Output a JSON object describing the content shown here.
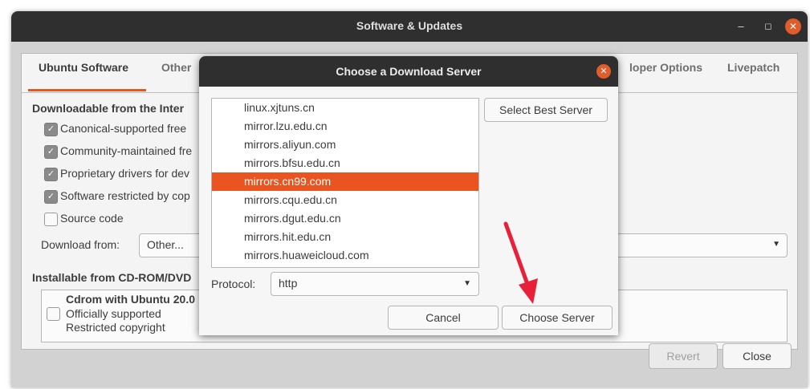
{
  "window": {
    "title": "Software & Updates",
    "controls": {
      "minimize": "–",
      "maximize": "◻",
      "close": "✕"
    }
  },
  "tabs": [
    {
      "label": "Ubuntu Software",
      "active": true
    },
    {
      "label": "Other",
      "active": false
    },
    {
      "label": "loper Options",
      "active": false
    },
    {
      "label": "Livepatch",
      "active": false
    }
  ],
  "downloadable": {
    "title": "Downloadable from the Inter",
    "items": [
      {
        "label": "Canonical-supported free",
        "checked": true
      },
      {
        "label": "Community-maintained fre",
        "checked": true
      },
      {
        "label": "Proprietary drivers for dev",
        "checked": true
      },
      {
        "label": "Software restricted by cop",
        "checked": true
      },
      {
        "label": "Source code",
        "checked": false
      }
    ],
    "download_from_label": "Download from:",
    "download_from_value": "Other..."
  },
  "cdrom": {
    "title": "Installable from CD-ROM/DVD",
    "name": "Cdrom with Ubuntu 20.0",
    "line2": "Officially supported",
    "line3": "Restricted copyright",
    "checked": false
  },
  "buttons": {
    "revert": "Revert",
    "close": "Close"
  },
  "dialog": {
    "title": "Choose a Download Server",
    "servers": [
      "linux.xjtuns.cn",
      "mirror.lzu.edu.cn",
      "mirrors.aliyun.com",
      "mirrors.bfsu.edu.cn",
      "mirrors.cn99.com",
      "mirrors.cqu.edu.cn",
      "mirrors.dgut.edu.cn",
      "mirrors.hit.edu.cn",
      "mirrors.huaweicloud.com"
    ],
    "selected_server": "mirrors.cn99.com",
    "select_best_label": "Select Best Server",
    "protocol_label": "Protocol:",
    "protocol_value": "http",
    "cancel_label": "Cancel",
    "choose_label": "Choose Server"
  },
  "colors": {
    "accent": "#e95420",
    "titlebar": "#2f2f2f",
    "annotation_arrow": "#e8203a"
  }
}
